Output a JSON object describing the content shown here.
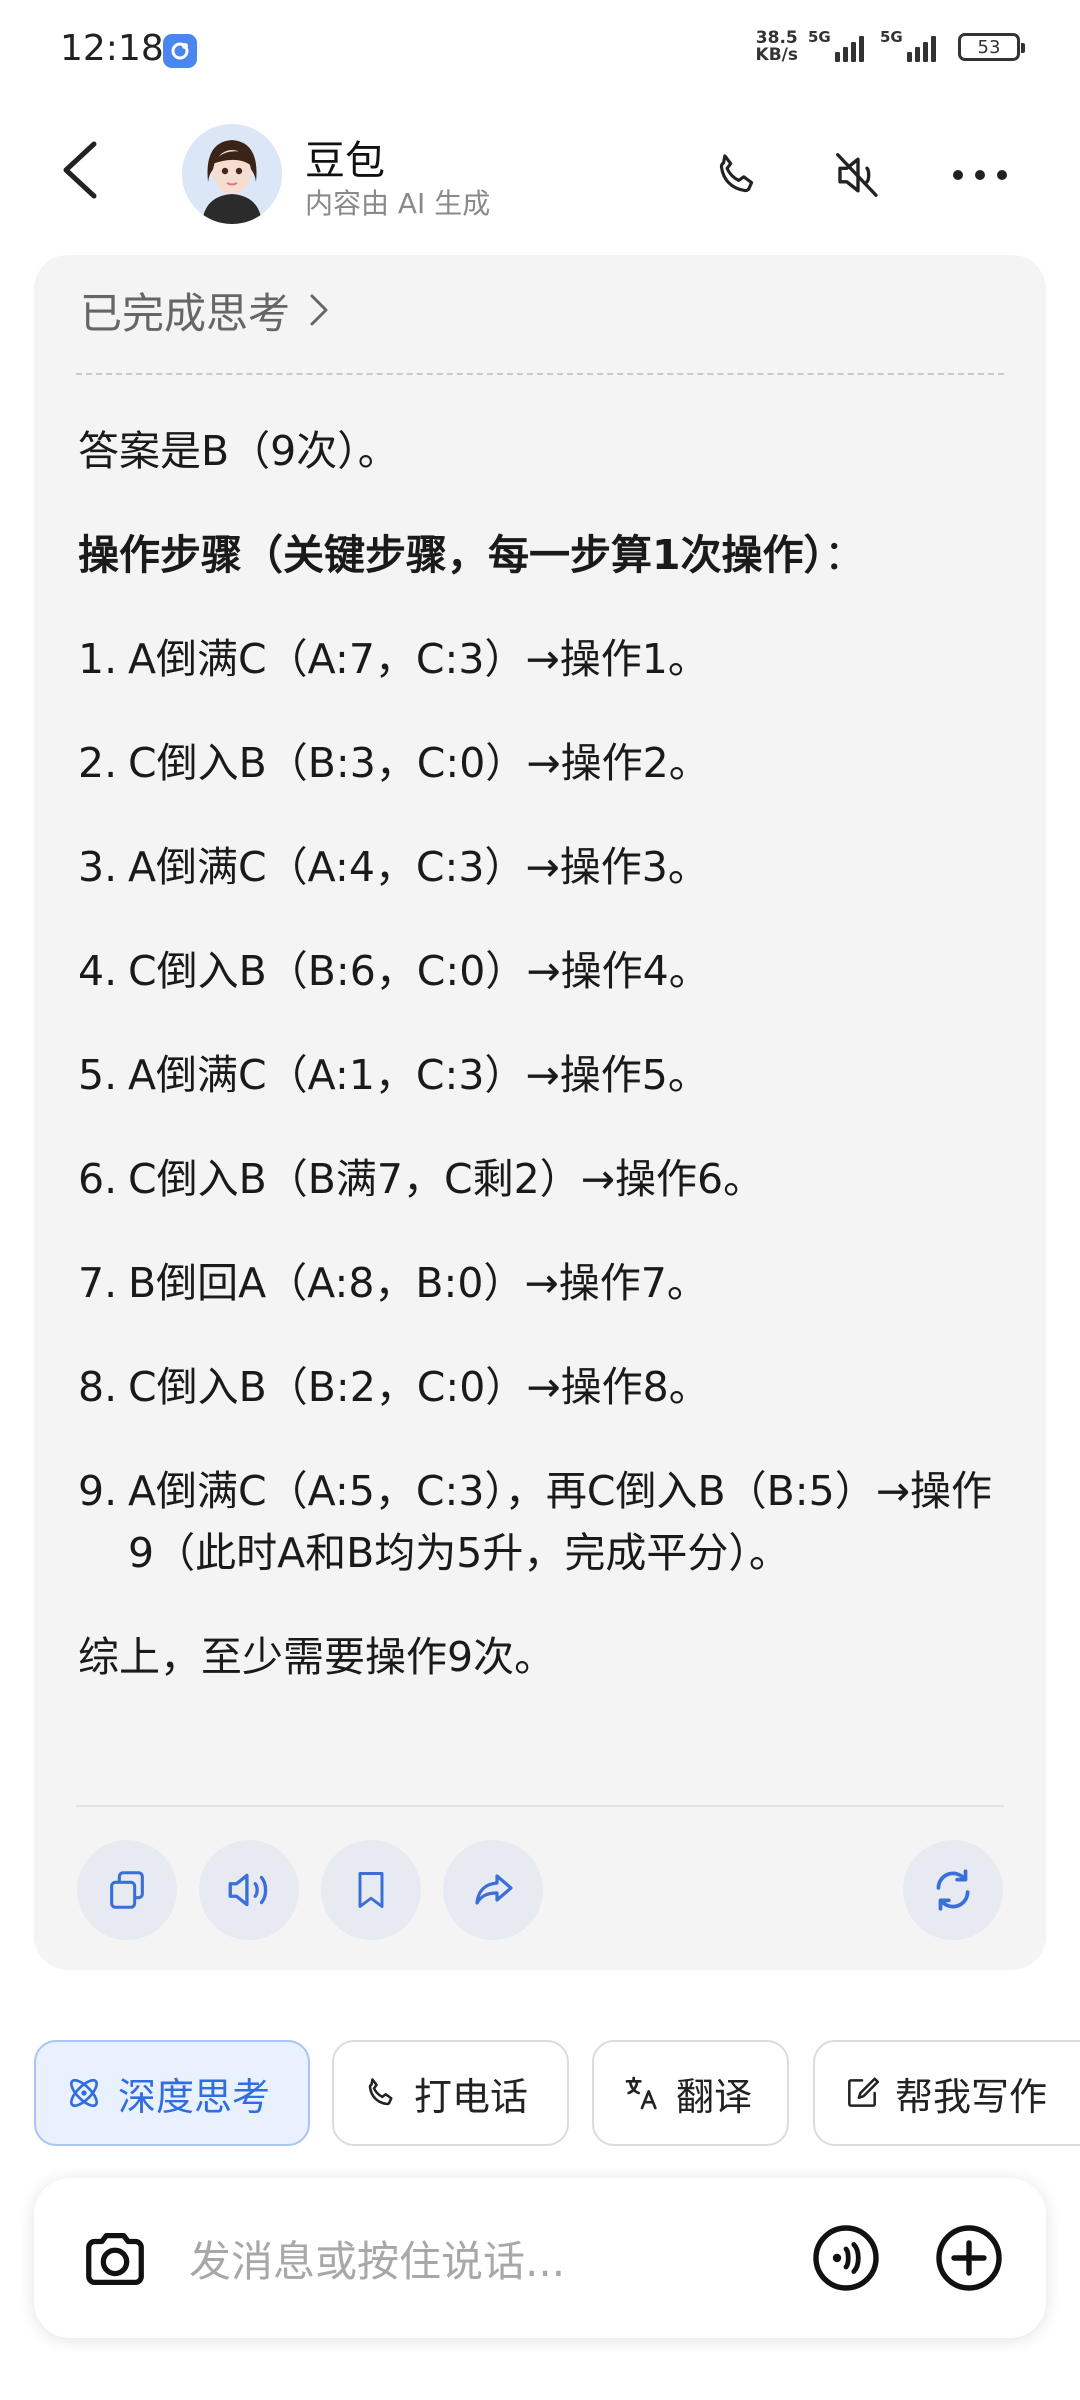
{
  "status_bar": {
    "time": "12:18",
    "net_speed_value": "38.5",
    "net_speed_unit": "KB/s",
    "sim1_label": "5G",
    "sim2_label": "5G",
    "battery": "53"
  },
  "header": {
    "name": "豆包",
    "subtitle": "内容由 AI 生成",
    "icons": [
      "back-arrow-icon",
      "phone-icon",
      "mute-speaker-icon",
      "more-icon"
    ]
  },
  "message": {
    "thinking_label": "已完成思考",
    "answer": "答案是B（9次）。",
    "steps_heading": "操作步骤（关键步骤，每一步算1次操作）",
    "steps_heading_suffix": "：",
    "steps": [
      {
        "num": "1.",
        "text": "A倒满C（A:7，C:3）→操作1。"
      },
      {
        "num": "2.",
        "text": "C倒入B（B:3，C:0）→操作2。"
      },
      {
        "num": "3.",
        "text": "A倒满C（A:4，C:3）→操作3。"
      },
      {
        "num": "4.",
        "text": "C倒入B（B:6，C:0）→操作4。"
      },
      {
        "num": "5.",
        "text": "A倒满C（A:1，C:3）→操作5。"
      },
      {
        "num": "6.",
        "text": "C倒入B（B满7，C剩2）→操作6。"
      },
      {
        "num": "7.",
        "text": "B倒回A（A:8，B:0）→操作7。"
      },
      {
        "num": "8.",
        "text": "C倒入B（B:2，C:0）→操作8。"
      },
      {
        "num": "9.",
        "text": "A倒满C（A:5，C:3），再C倒入B（B:5）→操作9（此时A和B均为5升，完成平分）。"
      }
    ],
    "conclusion": "综上，至少需要操作9次。",
    "actions": [
      "copy-icon",
      "speaker-icon",
      "bookmark-icon",
      "share-icon",
      "regenerate-icon"
    ]
  },
  "chips": [
    {
      "label": "深度思考",
      "icon": "atom-icon",
      "active": true
    },
    {
      "label": "打电话",
      "icon": "phone-icon",
      "active": false
    },
    {
      "label": "翻译",
      "icon": "translate-icon",
      "active": false
    },
    {
      "label": "帮我写作",
      "icon": "edit-icon",
      "active": false
    }
  ],
  "input": {
    "placeholder": "发消息或按住说话..."
  },
  "colors": {
    "accent": "#2f6de0",
    "card_bg": "#f4f4f5",
    "action_icon": "#3a6fd8"
  }
}
